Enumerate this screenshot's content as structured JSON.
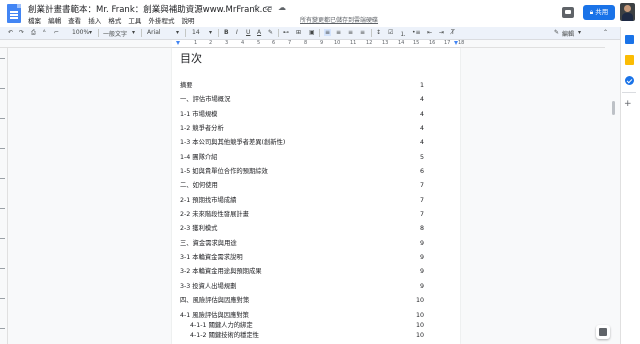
{
  "window": {
    "title": "創業計畫書範本：Mr. Frank：創業與補助資源www.MrFrank.cc",
    "save_status": "所有變更都已儲存到雲端硬碟"
  },
  "menu": [
    "檔案",
    "編輯",
    "查看",
    "插入",
    "格式",
    "工具",
    "外掛程式",
    "說明"
  ],
  "header": {
    "share_label": "共用",
    "share_icon": "lock-icon"
  },
  "toolbar": {
    "zoom": "100%",
    "style": "一般文字",
    "font": "Arial",
    "font_size": "14",
    "bold": "B",
    "italic": "I",
    "underline": "U",
    "text_color": "A",
    "mode": "編輯"
  },
  "ruler_numbers": [
    "1",
    "2",
    "3",
    "4",
    "5",
    "6",
    "7",
    "8",
    "9",
    "10",
    "11",
    "12",
    "13",
    "14",
    "15",
    "16",
    "17",
    "18"
  ],
  "toc": {
    "title": "目次",
    "entries": [
      {
        "text": "摘要",
        "page": "1"
      },
      {
        "text": "一、評估市場概況",
        "page": "4"
      },
      {
        "text": "1-1 市場規模",
        "page": "4"
      },
      {
        "text": "1-2 競爭者分析",
        "page": "4"
      },
      {
        "text": "1-3 本公司與其他競爭者差異(創新性)",
        "page": "4"
      },
      {
        "text": "1-4 團隊介紹",
        "page": "5"
      },
      {
        "text": "1-5 如與貴單位合作的預期綜效",
        "page": "6"
      },
      {
        "text": "二、如何使用",
        "page": "7"
      },
      {
        "text": "2-1 預期找市場成績",
        "page": "7"
      },
      {
        "text": "2-2 未來階段性發展計畫",
        "page": "7"
      },
      {
        "text": "2-3 獲利模式",
        "page": "8"
      },
      {
        "text": "三、資金需求與用途",
        "page": "9"
      },
      {
        "text": "3-1 本輪資金需求說明",
        "page": "9"
      },
      {
        "text": "3-2 本輪資金用途與預期成果",
        "page": "9"
      },
      {
        "text": "3-3 投資人出場規劃",
        "page": "9"
      },
      {
        "text": "四、風險評估與因應對策",
        "page": "10"
      },
      {
        "text": "4-1 風險評估與因應對策",
        "page": "10"
      },
      {
        "text": "4-1-1 關鍵人力的綁定",
        "page": "10"
      },
      {
        "text": "4-1-2 關鍵技術的穩定性",
        "page": "10"
      }
    ]
  }
}
